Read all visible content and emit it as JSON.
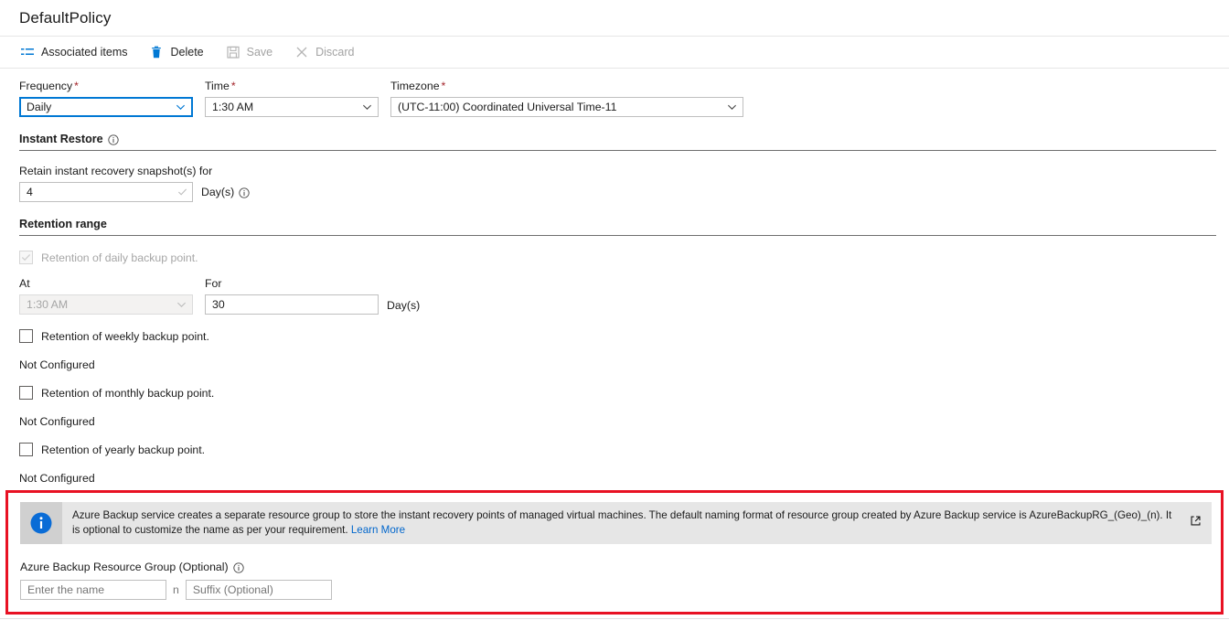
{
  "header": {
    "title": "DefaultPolicy"
  },
  "command_bar": {
    "items": [
      {
        "label": "Associated items",
        "icon": "list-icon",
        "disabled": false
      },
      {
        "label": "Delete",
        "icon": "trash-icon",
        "disabled": false
      },
      {
        "label": "Save",
        "icon": "save-icon",
        "disabled": true
      },
      {
        "label": "Discard",
        "icon": "close-icon",
        "disabled": true
      }
    ]
  },
  "schedule": {
    "frequency": {
      "label": "Frequency",
      "required": "*",
      "value": "Daily"
    },
    "time": {
      "label": "Time",
      "required": "*",
      "value": "1:30 AM"
    },
    "timezone": {
      "label": "Timezone",
      "required": "*",
      "value": "(UTC-11:00) Coordinated Universal Time-11"
    }
  },
  "instant_restore": {
    "title": "Instant Restore",
    "retain_label": "Retain instant recovery snapshot(s) for",
    "retain_value": "4",
    "units": "Day(s)"
  },
  "retention_range": {
    "title": "Retention range",
    "daily": {
      "label": "Retention of daily backup point.",
      "checked": true,
      "disabled": true,
      "at_label": "At",
      "at_value": "1:30 AM",
      "for_label": "For",
      "for_value": "30",
      "for_units": "Day(s)"
    },
    "weekly": {
      "label": "Retention of weekly backup point.",
      "checked": false,
      "status": "Not Configured"
    },
    "monthly": {
      "label": "Retention of monthly backup point.",
      "checked": false,
      "status": "Not Configured"
    },
    "yearly": {
      "label": "Retention of yearly backup point.",
      "checked": false,
      "status": "Not Configured"
    }
  },
  "resource_group": {
    "banner": {
      "text_before_link": "Azure Backup service creates a separate resource group to store the instant recovery points of managed virtual machines. The default naming format of resource group created by Azure Backup service is AzureBackupRG_(Geo)_(n). It is optional to customize the name as per your requirement. ",
      "link_label": "Learn More"
    },
    "label": "Azure Backup Resource Group (Optional)",
    "name_placeholder": "Enter the name",
    "separator": "n",
    "suffix_placeholder": "Suffix (Optional)"
  },
  "colors": {
    "accent": "#0078d4",
    "link": "#0066cc",
    "required": "#a4262c",
    "highlight": "#e81123",
    "banner_bg": "#e6e6e6"
  }
}
